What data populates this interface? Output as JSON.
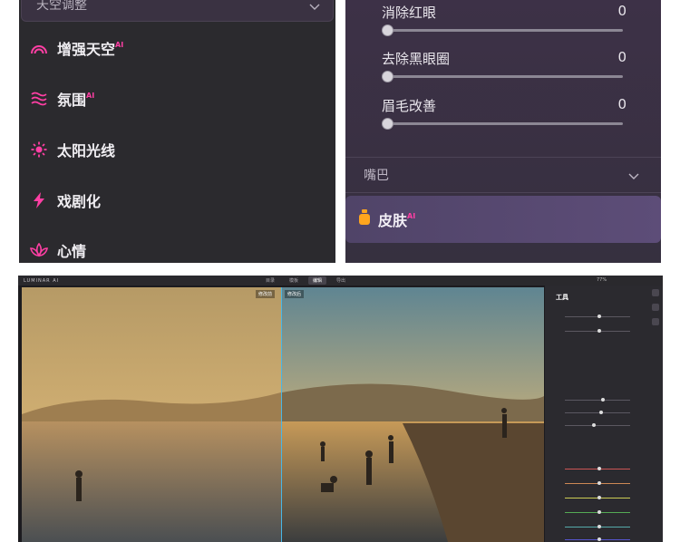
{
  "left_panel": {
    "dropdown_label": "天空调整",
    "items": [
      {
        "label": "增强天空",
        "ai": "AI",
        "icon": "rainbow-icon"
      },
      {
        "label": "氛围",
        "ai": "AI",
        "icon": "waves-icon"
      },
      {
        "label": "太阳光线",
        "ai": "",
        "icon": "sun-icon"
      },
      {
        "label": "戏剧化",
        "ai": "",
        "icon": "lightning-icon"
      },
      {
        "label": "心情",
        "ai": "",
        "icon": "lotus-icon"
      }
    ]
  },
  "right_panel": {
    "sliders": [
      {
        "label": "消除红眼",
        "value": "0"
      },
      {
        "label": "去除黑眼圈",
        "value": "0"
      },
      {
        "label": "眉毛改善",
        "value": "0"
      }
    ],
    "mouth_label": "嘴巴",
    "skin_label": "皮肤",
    "skin_ai": "AI",
    "skin_icon": "skin-bottle-icon"
  },
  "app": {
    "logo": "LUMINAR AI",
    "tabs": [
      "目录",
      "模板",
      "编辑",
      "导出"
    ],
    "active_tab": "编辑",
    "zoom": "77%",
    "before_label": "修改前",
    "after_label": "修改后",
    "tools_title": "工具",
    "colors": {
      "accent": "#ff3fa4",
      "divider": "#49b7e6"
    }
  }
}
